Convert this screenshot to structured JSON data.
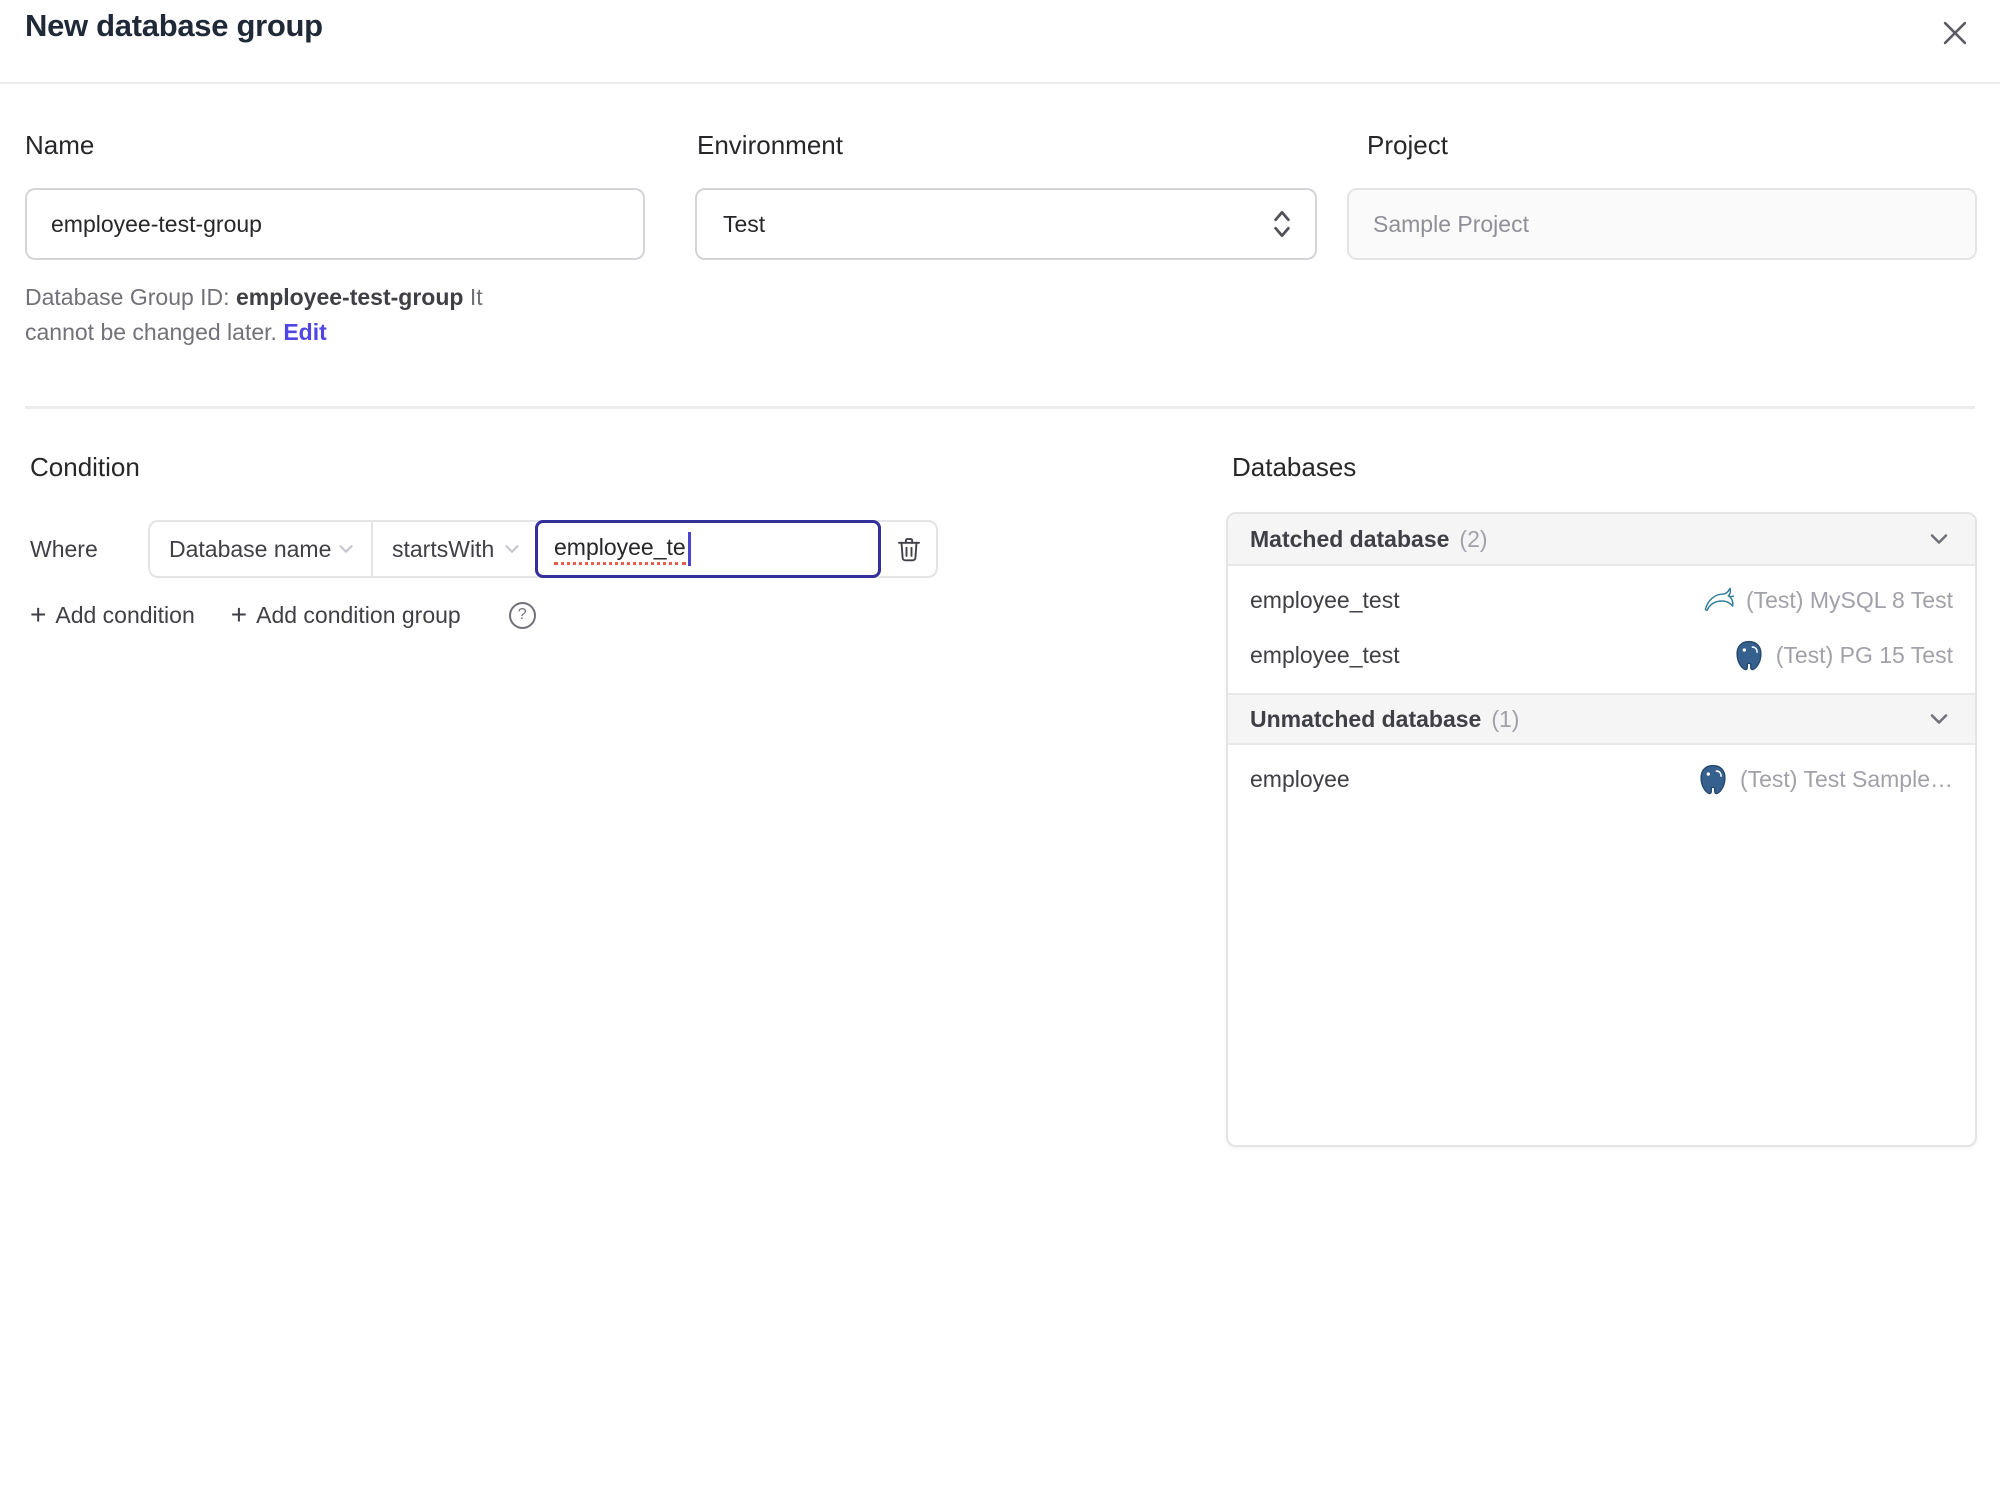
{
  "dialog": {
    "title": "New database group"
  },
  "form": {
    "name": {
      "label": "Name",
      "value": "employee-test-group"
    },
    "environment": {
      "label": "Environment",
      "value": "Test"
    },
    "project": {
      "label": "Project",
      "value": "Sample Project"
    },
    "id_hint": {
      "prefix": "Database Group ID: ",
      "id": "employee-test-group",
      "suffix": " It cannot be changed later. ",
      "edit_link": "Edit"
    }
  },
  "condition": {
    "heading": "Condition",
    "where_label": "Where",
    "factor": "Database name",
    "operator": "startsWith",
    "value": "employee_te",
    "add_condition_label": "Add condition",
    "add_condition_group_label": "Add condition group",
    "plus_glyph": "+",
    "help_glyph": "?"
  },
  "databases": {
    "heading": "Databases",
    "matched": {
      "title": "Matched database",
      "count": "(2)",
      "rows": [
        {
          "name": "employee_test",
          "engine": "mysql",
          "instance": "(Test) MySQL 8 Test"
        },
        {
          "name": "employee_test",
          "engine": "postgresql",
          "instance": "(Test) PG 15 Test"
        }
      ]
    },
    "unmatched": {
      "title": "Unmatched database",
      "count": "(1)",
      "rows": [
        {
          "name": "employee",
          "engine": "postgresql",
          "instance": "(Test) Test Sample…"
        }
      ]
    }
  },
  "colors": {
    "accent": "#4f46e5",
    "focus_border": "#34309b",
    "spellcheck_underline": "#e8604c",
    "mysql_icon": "#2f7e9b",
    "postgres_icon": "#36618e",
    "muted_text": "#a1a1aa",
    "band_background": "#f5f5f6",
    "border": "#e4e4e7"
  }
}
